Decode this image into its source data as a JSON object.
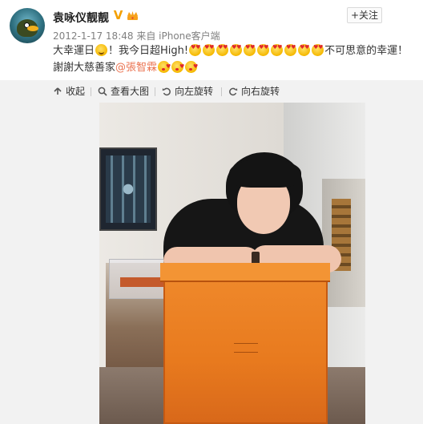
{
  "post": {
    "username": "袁咏仪靓靓",
    "verified_badge": "V",
    "follow_label": "+关注",
    "timestamp": "2012-1-17 18:48",
    "source": "来自 iPhone客户端",
    "text_part1": "大幸運日",
    "text_part2": "！我今日超High!",
    "text_part3": "不可思意的幸運！",
    "text_line2": "謝謝大慈善家",
    "mention": "@張智霖"
  },
  "toolbar": {
    "collapse": "收起",
    "view_large": "查看大图",
    "rotate_left": "向左旋转",
    "rotate_right": "向右旋转"
  },
  "icons": {
    "emoji_smile": "smile-emoji-icon",
    "emoji_heart_eyes": "heart-eyes-emoji-icon",
    "emoji_kiss": "kiss-emoji-icon"
  }
}
